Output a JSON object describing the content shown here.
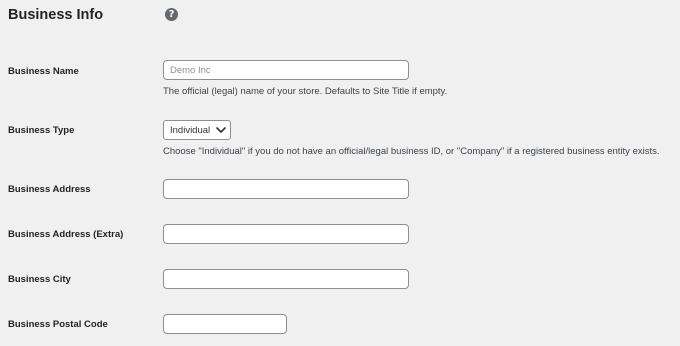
{
  "section": {
    "title": "Business Info",
    "help_icon": "question-mark-icon",
    "help_glyph": "?"
  },
  "fields": {
    "business_name": {
      "label": "Business Name",
      "placeholder": "Demo Inc",
      "value": "",
      "description": "The official (legal) name of your store. Defaults to Site Title if empty."
    },
    "business_type": {
      "label": "Business Type",
      "selected": "Individual",
      "description": "Choose \"Individual\" if you do not have an official/legal business ID, or \"Company\" if a registered business entity exists."
    },
    "business_address": {
      "label": "Business Address",
      "value": ""
    },
    "business_address_extra": {
      "label": "Business Address (Extra)",
      "value": ""
    },
    "business_city": {
      "label": "Business City",
      "value": ""
    },
    "business_postal_code": {
      "label": "Business Postal Code",
      "value": ""
    }
  },
  "colors": {
    "background": "#f0f0f1",
    "border": "#8c8f94",
    "text": "#1d2327",
    "help_icon": "#646970"
  }
}
